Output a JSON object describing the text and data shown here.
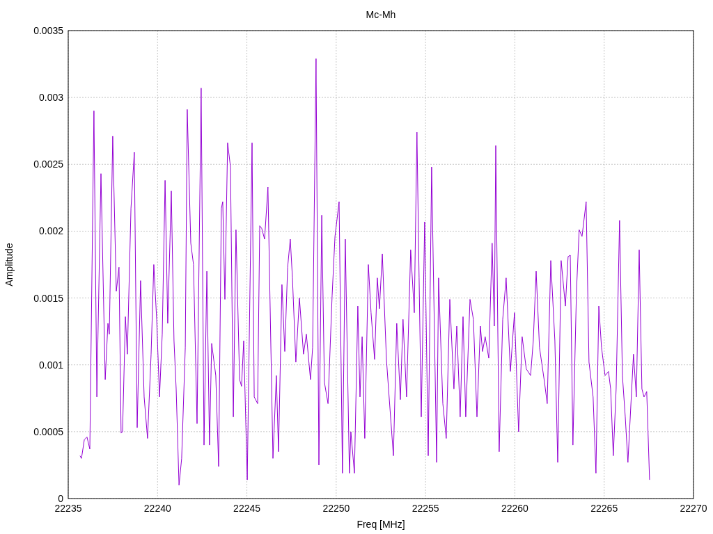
{
  "chart_data": {
    "type": "line",
    "title": "Mc-Mh",
    "xlabel": "Freq [MHz]",
    "ylabel": "Amplitude",
    "grid": true,
    "xlim": [
      22235,
      22270
    ],
    "ylim": [
      0,
      0.0035
    ],
    "xticks": [
      22235,
      22240,
      22245,
      22250,
      22255,
      22260,
      22265,
      22270
    ],
    "yticks": [
      0,
      0.0005,
      0.001,
      0.0015,
      0.002,
      0.0025,
      0.003,
      0.0035
    ],
    "x": [
      22235.66,
      22235.74,
      22235.9,
      22236.05,
      22236.21,
      22236.44,
      22236.6,
      22236.83,
      22237.07,
      22237.22,
      22237.3,
      22237.49,
      22237.69,
      22237.84,
      22237.96,
      22238.04,
      22238.2,
      22238.31,
      22238.51,
      22238.7,
      22238.86,
      22239.05,
      22239.25,
      22239.44,
      22239.64,
      22239.79,
      22239.95,
      22240.11,
      22240.26,
      22240.42,
      22240.57,
      22240.77,
      22240.92,
      22241.04,
      22241.2,
      22241.35,
      22241.55,
      22241.66,
      22241.86,
      22242.01,
      22242.21,
      22242.44,
      22242.6,
      22242.76,
      22242.91,
      22243.03,
      22243.26,
      22243.42,
      22243.57,
      22243.65,
      22243.77,
      22243.92,
      22244.08,
      22244.24,
      22244.39,
      22244.59,
      22244.7,
      22244.82,
      22245.02,
      22245.29,
      22245.41,
      22245.6,
      22245.72,
      22245.83,
      22245.99,
      22246.18,
      22246.46,
      22246.65,
      22246.77,
      22246.96,
      22247.12,
      22247.28,
      22247.43,
      22247.55,
      22247.74,
      22247.94,
      22248.17,
      22248.33,
      22248.56,
      22248.68,
      22248.87,
      22249.03,
      22249.19,
      22249.34,
      22249.54,
      22249.77,
      22249.93,
      22250.16,
      22250.35,
      22250.51,
      22250.74,
      22250.82,
      22251.02,
      22251.21,
      22251.33,
      22251.45,
      22251.6,
      22251.8,
      22251.95,
      22252.15,
      22252.3,
      22252.42,
      22252.58,
      22252.81,
      22252.93,
      22253.2,
      22253.39,
      22253.59,
      22253.74,
      22253.94,
      22254.17,
      22254.37,
      22254.52,
      22254.64,
      22254.76,
      22254.95,
      22255.15,
      22255.34,
      22255.62,
      22255.73,
      22255.97,
      22256.16,
      22256.36,
      22256.59,
      22256.75,
      22256.94,
      22257.1,
      22257.25,
      22257.49,
      22257.68,
      22257.88,
      22258.07,
      22258.19,
      22258.34,
      22258.54,
      22258.73,
      22258.85,
      22258.93,
      22259.12,
      22259.32,
      22259.51,
      22259.75,
      22259.98,
      22260.21,
      22260.41,
      22260.64,
      22260.88,
      22261.03,
      22261.19,
      22261.38,
      22261.66,
      22261.81,
      22262.01,
      22262.24,
      22262.4,
      22262.59,
      22262.83,
      22262.98,
      22263.1,
      22263.25,
      22263.45,
      22263.6,
      22263.76,
      22263.99,
      22264.15,
      22264.38,
      22264.54,
      22264.7,
      22264.85,
      22265.05,
      22265.24,
      22265.36,
      22265.51,
      22265.67,
      22265.86,
      22266.02,
      22266.18,
      22266.33,
      22266.64,
      22266.8,
      22266.96,
      22267.11,
      22267.23,
      22267.38,
      22267.54
    ],
    "series": [
      {
        "color": "#9400d3",
        "values": [
          0.00032,
          0.0003,
          0.00044,
          0.00046,
          0.00037,
          0.0029,
          0.00076,
          0.00243,
          0.00089,
          0.00131,
          0.00123,
          0.00271,
          0.00155,
          0.00173,
          0.00049,
          0.0005,
          0.00136,
          0.00108,
          0.00217,
          0.00259,
          0.00053,
          0.00163,
          0.00076,
          0.00045,
          0.00108,
          0.00175,
          0.00134,
          0.00076,
          0.00123,
          0.00238,
          0.00131,
          0.0023,
          0.00118,
          0.00082,
          0.0001,
          0.0003,
          0.00113,
          0.00291,
          0.00191,
          0.00175,
          0.00056,
          0.00307,
          0.0004,
          0.0017,
          0.0004,
          0.00116,
          0.00092,
          0.00024,
          0.00217,
          0.00222,
          0.00149,
          0.00266,
          0.00248,
          0.00061,
          0.00201,
          0.00089,
          0.00084,
          0.00118,
          0.00014,
          0.00266,
          0.00076,
          0.00071,
          0.00204,
          0.00202,
          0.00194,
          0.00233,
          0.0003,
          0.00092,
          0.00035,
          0.0016,
          0.0011,
          0.00173,
          0.00194,
          0.00165,
          0.00102,
          0.0015,
          0.00108,
          0.00123,
          0.00089,
          0.00113,
          0.00329,
          0.00025,
          0.00212,
          0.00087,
          0.00071,
          0.00152,
          0.00196,
          0.00222,
          0.00019,
          0.00194,
          0.00019,
          0.0005,
          0.00019,
          0.00144,
          0.00076,
          0.00121,
          0.00045,
          0.00175,
          0.00139,
          0.00104,
          0.00165,
          0.00142,
          0.00183,
          0.00104,
          0.00082,
          0.00032,
          0.00131,
          0.00074,
          0.00134,
          0.00076,
          0.00186,
          0.00139,
          0.00274,
          0.00165,
          0.00061,
          0.00207,
          0.00032,
          0.00248,
          0.00027,
          0.00165,
          0.00071,
          0.00045,
          0.00149,
          0.00082,
          0.00129,
          0.00061,
          0.00136,
          0.00061,
          0.00149,
          0.00134,
          0.00061,
          0.00129,
          0.0011,
          0.00121,
          0.00105,
          0.00191,
          0.00129,
          0.00264,
          0.00035,
          0.00134,
          0.00165,
          0.00095,
          0.00139,
          0.0005,
          0.00121,
          0.00097,
          0.00092,
          0.00118,
          0.0017,
          0.00113,
          0.00087,
          0.00071,
          0.00178,
          0.00118,
          0.00027,
          0.00178,
          0.00144,
          0.00181,
          0.00182,
          0.0004,
          0.00155,
          0.00201,
          0.00196,
          0.00222,
          0.00102,
          0.00076,
          0.00019,
          0.00144,
          0.00113,
          0.00092,
          0.00095,
          0.00082,
          0.00032,
          0.00082,
          0.00208,
          0.00092,
          0.00061,
          0.00027,
          0.00108,
          0.00076,
          0.00186,
          0.00082,
          0.00076,
          0.0008,
          0.00014
        ]
      }
    ]
  }
}
